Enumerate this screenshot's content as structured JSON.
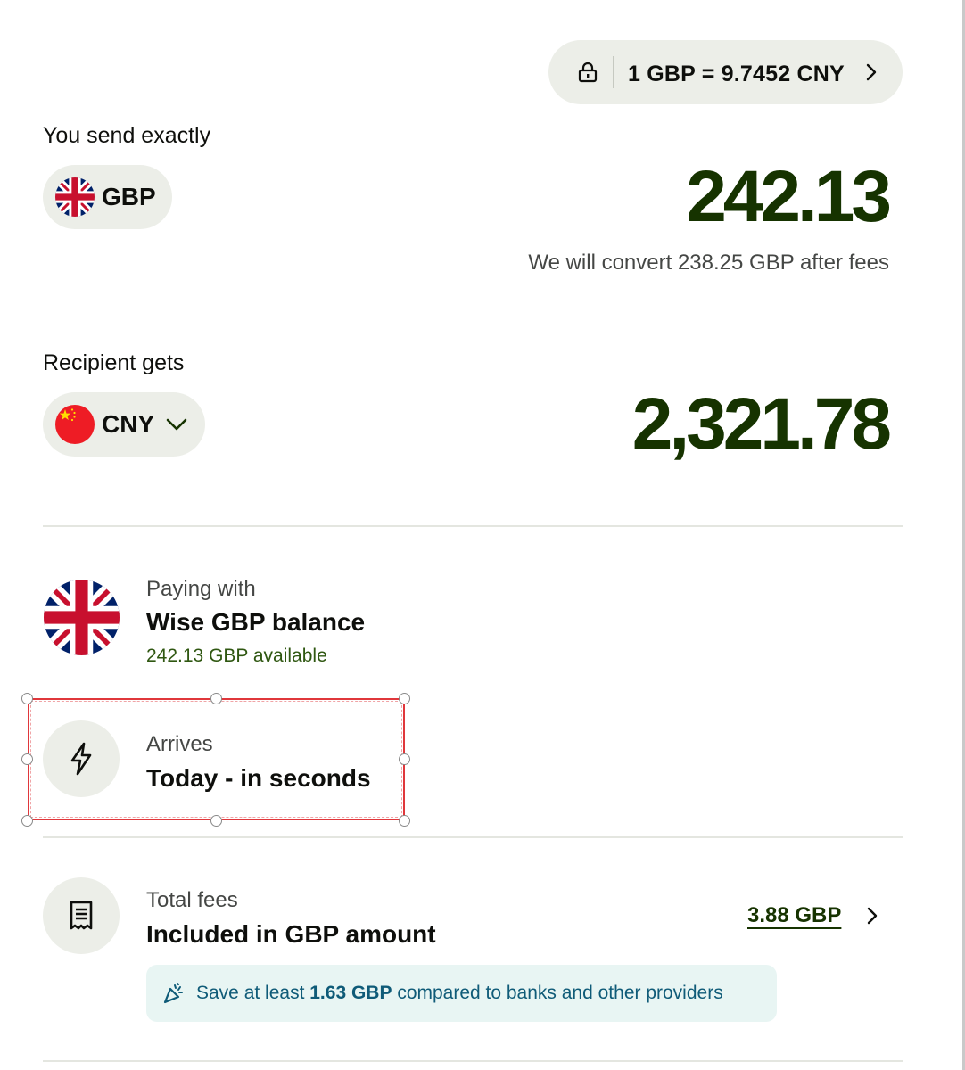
{
  "rate": {
    "text": "1 GBP = 9.7452 CNY",
    "lock_icon": "lock-icon",
    "chevron_icon": "chevron-right-icon"
  },
  "send": {
    "label": "You send exactly",
    "currency": "GBP",
    "flag_icon": "uk-flag-icon",
    "amount": "242.13",
    "note": "We will convert 238.25 GBP after fees"
  },
  "recipient": {
    "label": "Recipient gets",
    "currency": "CNY",
    "flag_icon": "china-flag-icon",
    "dropdown_icon": "chevron-down-icon",
    "amount": "2,321.78"
  },
  "paying": {
    "label": "Paying with",
    "method": "Wise GBP balance",
    "available": "242.13 GBP available"
  },
  "arrives": {
    "label": "Arrives",
    "value": "Today - in seconds",
    "icon": "lightning-icon"
  },
  "fees": {
    "label": "Total fees",
    "value": "Included in GBP amount",
    "amount": "3.88 GBP",
    "icon": "receipt-icon"
  },
  "savings": {
    "prefix": "Save at least",
    "amount": "1.63 GBP",
    "suffix": "compared to banks and other providers",
    "icon": "confetti-icon"
  },
  "colors": {
    "amount_green": "#163300",
    "pill_bg": "#eceee8",
    "savings_bg": "#e8f5f3",
    "savings_text": "#0f5b78",
    "selection_red": "#e0373b"
  }
}
